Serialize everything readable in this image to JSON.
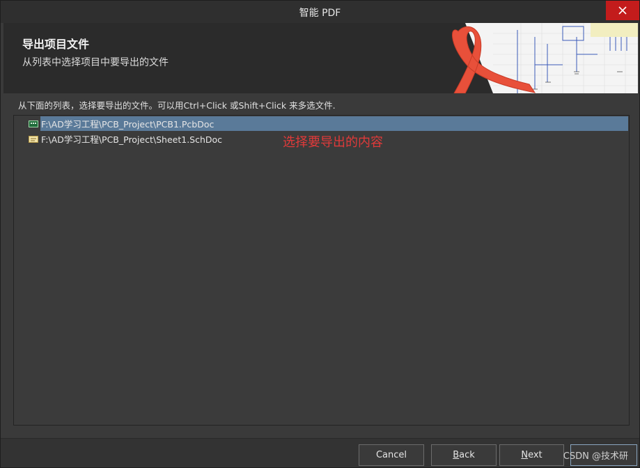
{
  "window": {
    "title": "智能 PDF",
    "close_icon": "close-icon"
  },
  "header": {
    "title": "导出项目文件",
    "subtitle": "从列表中选择项目中要导出的文件"
  },
  "instruction": "从下面的列表，选择要导出的文件。可以用Ctrl+Click 或Shift+Click 来多选文件.",
  "files": [
    {
      "path": "F:\\AD学习工程\\PCB_Project\\PCB1.PcbDoc",
      "icon": "pcb-doc-icon",
      "selected": true
    },
    {
      "path": "F:\\AD学习工程\\PCB_Project\\Sheet1.SchDoc",
      "icon": "sch-doc-icon",
      "selected": false
    }
  ],
  "annotation": "选择要导出的内容",
  "buttons": {
    "cancel": "Cancel",
    "back_mnemonic": "B",
    "back_rest": "ack",
    "next_mnemonic": "N",
    "next_rest": "ext",
    "finish_label": ""
  },
  "watermark": "CSDN @技术研",
  "colors": {
    "selection": "#5a7a99",
    "annotation": "#e03a3a",
    "close": "#c31c1c",
    "pdf_logo": "#e8503a"
  }
}
